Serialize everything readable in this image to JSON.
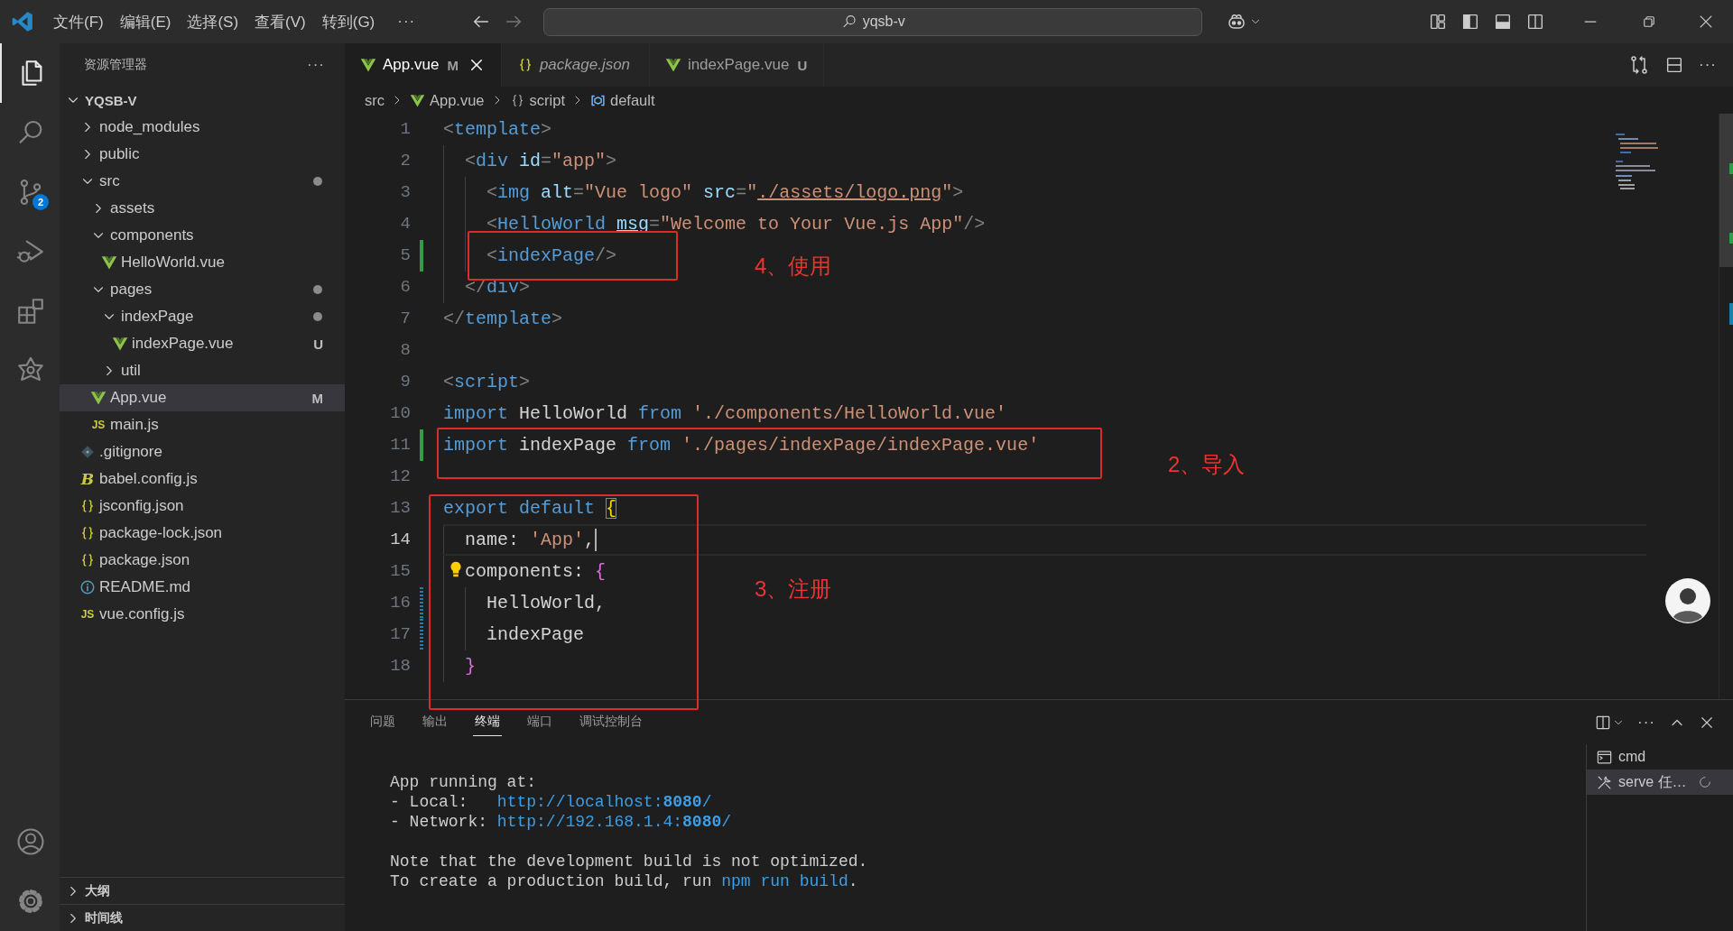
{
  "titlebar": {
    "menus": [
      "文件(F)",
      "编辑(E)",
      "选择(S)",
      "查看(V)",
      "转到(G)"
    ],
    "more": "···",
    "search": {
      "value": "yqsb-v"
    }
  },
  "activity_bar": {
    "top": [
      {
        "kind": "explorer",
        "selected": true
      },
      {
        "kind": "search",
        "selected": false
      },
      {
        "kind": "source-control",
        "selected": false,
        "badge": "2"
      },
      {
        "kind": "run-debug",
        "selected": false
      },
      {
        "kind": "extensions",
        "selected": false
      },
      {
        "kind": "star",
        "selected": false
      }
    ],
    "bottom": [
      {
        "kind": "account"
      },
      {
        "kind": "settings"
      }
    ]
  },
  "explorer": {
    "title": "资源管理器",
    "more": "···",
    "root": {
      "label": "YQSB-V",
      "expanded": true
    },
    "tree": [
      {
        "label": "node_modules",
        "kind": "folder",
        "expanded": false,
        "selected": false,
        "dot": false
      },
      {
        "label": "public",
        "kind": "folder",
        "expanded": false,
        "selected": false,
        "dot": false
      },
      {
        "label": "src",
        "kind": "folder",
        "expanded": true,
        "selected": false,
        "dot": true,
        "children": [
          {
            "label": "assets",
            "kind": "folder",
            "expanded": false,
            "selected": false,
            "dot": false
          },
          {
            "label": "components",
            "kind": "folder",
            "expanded": true,
            "selected": false,
            "dot": false,
            "children": [
              {
                "label": "HelloWorld.vue",
                "kind": "vue",
                "selected": false,
                "dot": false
              }
            ]
          },
          {
            "label": "pages",
            "kind": "folder",
            "expanded": true,
            "selected": false,
            "dot": true,
            "children": [
              {
                "label": "indexPage",
                "kind": "folder",
                "expanded": true,
                "selected": false,
                "dot": true,
                "children": [
                  {
                    "label": "indexPage.vue",
                    "kind": "vue",
                    "selected": false,
                    "dot": false,
                    "badge": "U"
                  }
                ]
              },
              {
                "label": "util",
                "kind": "folder",
                "expanded": false,
                "selected": false,
                "dot": false
              }
            ]
          },
          {
            "label": "App.vue",
            "kind": "vue",
            "selected": true,
            "dot": false,
            "badge": "M"
          },
          {
            "label": "main.js",
            "kind": "js",
            "icon_text": "JS",
            "selected": false,
            "dot": false
          }
        ]
      },
      {
        "label": ".gitignore",
        "kind": "git",
        "selected": false,
        "dot": false
      },
      {
        "label": "babel.config.js",
        "kind": "babel",
        "icon_text": "B",
        "selected": false,
        "dot": false
      },
      {
        "label": "jsconfig.json",
        "kind": "json",
        "selected": false,
        "dot": false
      },
      {
        "label": "package-lock.json",
        "kind": "json",
        "selected": false,
        "dot": false
      },
      {
        "label": "package.json",
        "kind": "json",
        "selected": false,
        "dot": false
      },
      {
        "label": "README.md",
        "kind": "info",
        "selected": false,
        "dot": false
      },
      {
        "label": "vue.config.js",
        "kind": "js",
        "icon_text": "JS",
        "selected": false,
        "dot": false
      }
    ],
    "sections": [
      {
        "label": "大纲",
        "expanded": false
      },
      {
        "label": "时间线",
        "expanded": false
      }
    ]
  },
  "editor": {
    "tabs": [
      {
        "label": "App.vue",
        "kind": "vue",
        "badge": "M",
        "selected": true,
        "preview": false
      },
      {
        "label": "package.json",
        "kind": "json",
        "selected": false,
        "preview": true
      },
      {
        "label": "indexPage.vue",
        "kind": "vue",
        "badge": "U",
        "selected": false,
        "preview": false
      }
    ],
    "more": "···",
    "breadcrumb": [
      {
        "label": "src",
        "kind": "folder"
      },
      {
        "label": "App.vue",
        "kind": "vue"
      },
      {
        "label": "script",
        "kind": "braces"
      },
      {
        "label": "default",
        "kind": "symbol"
      }
    ],
    "lines": [
      {
        "n": "1",
        "added": false,
        "modified": false,
        "current": false,
        "lightbulb": false,
        "tokens": [
          {
            "kind": "punct",
            "text": "<"
          },
          {
            "kind": "tag",
            "text": "template"
          },
          {
            "kind": "punct",
            "text": ">"
          }
        ]
      },
      {
        "n": "2",
        "added": false,
        "modified": false,
        "current": false,
        "lightbulb": false,
        "tokens": [
          {
            "kind": "punct",
            "text": "  <"
          },
          {
            "kind": "tag",
            "text": "div"
          },
          {
            "kind": "attr",
            "text": " id"
          },
          {
            "kind": "punct",
            "text": "="
          },
          {
            "kind": "string",
            "text": "\"app\""
          },
          {
            "kind": "punct",
            "text": ">"
          }
        ]
      },
      {
        "n": "3",
        "added": false,
        "modified": false,
        "current": false,
        "lightbulb": false,
        "tokens": [
          {
            "kind": "punct",
            "text": "    <"
          },
          {
            "kind": "tag",
            "text": "img"
          },
          {
            "kind": "attr",
            "text": " alt"
          },
          {
            "kind": "punct",
            "text": "="
          },
          {
            "kind": "string",
            "text": "\"Vue logo\""
          },
          {
            "kind": "attr",
            "text": " src"
          },
          {
            "kind": "punct",
            "text": "="
          },
          {
            "kind": "string",
            "text": "\""
          },
          {
            "kind": "string-link",
            "text": "./assets/logo.png"
          },
          {
            "kind": "string",
            "text": "\""
          },
          {
            "kind": "punct",
            "text": ">"
          }
        ]
      },
      {
        "n": "4",
        "added": false,
        "modified": false,
        "current": false,
        "lightbulb": false,
        "tokens": [
          {
            "kind": "punct",
            "text": "    <"
          },
          {
            "kind": "tag",
            "text": "HelloWorld "
          },
          {
            "kind": "attr-link",
            "text": "msg"
          },
          {
            "kind": "punct",
            "text": "="
          },
          {
            "kind": "string",
            "text": "\"Welcome to Your Vue.js App\""
          },
          {
            "kind": "punct",
            "text": "/>"
          }
        ]
      },
      {
        "n": "5",
        "added": true,
        "modified": false,
        "current": false,
        "lightbulb": false,
        "tokens": [
          {
            "kind": "punct",
            "text": "    <"
          },
          {
            "kind": "tag",
            "text": "indexPage"
          },
          {
            "kind": "punct",
            "text": "/>"
          }
        ]
      },
      {
        "n": "6",
        "added": false,
        "modified": false,
        "current": false,
        "lightbulb": false,
        "tokens": [
          {
            "kind": "punct",
            "text": "  </"
          },
          {
            "kind": "tag",
            "text": "div"
          },
          {
            "kind": "punct",
            "text": ">"
          }
        ]
      },
      {
        "n": "7",
        "added": false,
        "modified": false,
        "current": false,
        "lightbulb": false,
        "tokens": [
          {
            "kind": "punct",
            "text": "</"
          },
          {
            "kind": "tag",
            "text": "template"
          },
          {
            "kind": "punct",
            "text": ">"
          }
        ]
      },
      {
        "n": "8",
        "added": false,
        "modified": false,
        "current": false,
        "lightbulb": false
      },
      {
        "n": "9",
        "added": false,
        "modified": false,
        "current": false,
        "lightbulb": false,
        "tokens": [
          {
            "kind": "punct",
            "text": "<"
          },
          {
            "kind": "tag",
            "text": "script"
          },
          {
            "kind": "punct",
            "text": ">"
          }
        ]
      },
      {
        "n": "10",
        "added": false,
        "modified": false,
        "current": false,
        "lightbulb": false,
        "tokens": [
          {
            "kind": "keyword",
            "text": "import"
          },
          {
            "kind": "text",
            "text": " HelloWorld "
          },
          {
            "kind": "keyword",
            "text": "from"
          },
          {
            "kind": "string",
            "text": " './components/HelloWorld.vue'"
          }
        ]
      },
      {
        "n": "11",
        "added": true,
        "modified": false,
        "current": false,
        "lightbulb": false,
        "tokens": [
          {
            "kind": "keyword",
            "text": "import"
          },
          {
            "kind": "text",
            "text": " indexPage "
          },
          {
            "kind": "keyword",
            "text": "from"
          },
          {
            "kind": "string",
            "text": " './pages/indexPage/indexPage.vue'"
          }
        ]
      },
      {
        "n": "12",
        "added": false,
        "modified": false,
        "current": false,
        "lightbulb": false
      },
      {
        "n": "13",
        "added": false,
        "modified": false,
        "current": false,
        "lightbulb": false,
        "tokens": [
          {
            "kind": "keyword",
            "text": "export default "
          },
          {
            "kind": "bracket-match",
            "text": "{"
          }
        ]
      },
      {
        "n": "14",
        "added": false,
        "modified": false,
        "current": true,
        "lightbulb": false,
        "tokens": [
          {
            "kind": "text",
            "text": "  name: "
          },
          {
            "kind": "string",
            "text": "'App'"
          },
          {
            "kind": "text",
            "text": ","
          }
        ]
      },
      {
        "n": "15",
        "added": false,
        "modified": false,
        "current": false,
        "lightbulb": true,
        "tokens": [
          {
            "kind": "text",
            "text": "  components: "
          },
          {
            "kind": "bracket-pink",
            "text": "{"
          }
        ]
      },
      {
        "n": "16",
        "added": false,
        "modified": true,
        "current": false,
        "lightbulb": false,
        "tokens": [
          {
            "kind": "text",
            "text": "    HelloWorld,"
          }
        ]
      },
      {
        "n": "17",
        "added": false,
        "modified": true,
        "current": false,
        "lightbulb": false,
        "tokens": [
          {
            "kind": "text",
            "text": "    indexPage"
          }
        ]
      },
      {
        "n": "18",
        "added": false,
        "modified": false,
        "current": false,
        "lightbulb": false,
        "tokens": [
          {
            "kind": "bracket-pink",
            "text": "  }"
          }
        ]
      }
    ]
  },
  "panel": {
    "tabs": [
      {
        "label": "问题",
        "selected": false
      },
      {
        "label": "输出",
        "selected": false
      },
      {
        "label": "终端",
        "selected": true
      },
      {
        "label": "端口",
        "selected": false
      },
      {
        "label": "调试控制台",
        "selected": false
      }
    ],
    "more": "···",
    "terminal": {
      "blocks": [
        [
          [
            {
              "kind": "text",
              "text": "App running at:"
            }
          ],
          [
            {
              "kind": "text",
              "text": "- Local:   "
            },
            {
              "kind": "link",
              "text": "http://localhost:**8080**/"
            }
          ],
          [
            {
              "kind": "text",
              "text": "- Network: "
            },
            {
              "kind": "link",
              "text": "http://192.168.1.4:**8080**/"
            }
          ]
        ],
        [
          [
            {
              "kind": "text",
              "text": "Note that the development build is not optimized."
            }
          ],
          [
            {
              "kind": "text",
              "text": "To create a production build, run "
            },
            {
              "kind": "command",
              "text": "npm run build"
            },
            {
              "kind": "text",
              "text": "."
            }
          ]
        ]
      ]
    },
    "terminals": [
      {
        "label": "cmd",
        "kind": "terminal",
        "selected": false,
        "busy": false
      },
      {
        "label": "serve 任…",
        "kind": "tools",
        "selected": true,
        "busy": true
      }
    ]
  },
  "annotations": [
    {
      "label": "4、使用"
    },
    {
      "label": "2、导入"
    },
    {
      "label": "3、注册"
    }
  ]
}
